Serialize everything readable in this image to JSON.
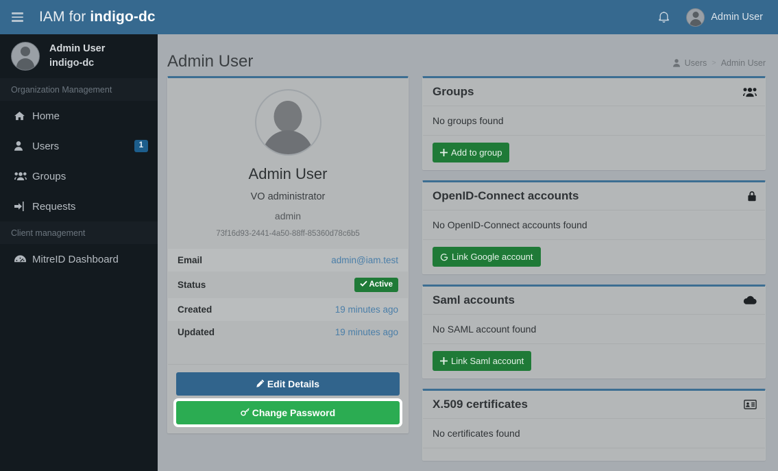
{
  "navbar": {
    "menu_icon": "hamburger-icon",
    "brand_prefix": "IAM for ",
    "brand_org": "indigo-dc",
    "bell_icon": "bell-icon",
    "user_name": "Admin User"
  },
  "sidebar": {
    "profile": {
      "name": "Admin User",
      "org": "indigo-dc"
    },
    "sections": [
      {
        "header": "Organization Management",
        "items": [
          {
            "label": "Home",
            "icon": "home-icon",
            "badge": null
          },
          {
            "label": "Users",
            "icon": "user-icon",
            "badge": "1"
          },
          {
            "label": "Groups",
            "icon": "users-icon",
            "badge": null
          },
          {
            "label": "Requests",
            "icon": "sign-in-icon",
            "badge": null
          }
        ]
      },
      {
        "header": "Client management",
        "items": [
          {
            "label": "MitreID Dashboard",
            "icon": "dashboard-icon",
            "badge": null
          }
        ]
      }
    ]
  },
  "content": {
    "page_title": "Admin User",
    "breadcrumb": {
      "icon": "user-icon",
      "link": "Users",
      "separator": ">",
      "current": "Admin User"
    }
  },
  "profile": {
    "avatar_icon": "avatar-placeholder-icon",
    "name": "Admin User",
    "role": "VO administrator",
    "username": "admin",
    "uuid": "73f16d93-2441-4a50-88ff-85360d78c6b5",
    "fields": [
      {
        "key": "Email",
        "value": "admin@iam.test",
        "type": "link"
      },
      {
        "key": "Status",
        "value": "Active",
        "type": "badge",
        "badge_icon": "check-icon"
      },
      {
        "key": "Created",
        "value": "19 minutes ago",
        "type": "link"
      },
      {
        "key": "Updated",
        "value": "19 minutes ago",
        "type": "link"
      }
    ],
    "actions": {
      "edit_label": "Edit Details",
      "edit_icon": "pencil-icon",
      "password_label": "Change Password",
      "password_icon": "key-icon"
    }
  },
  "panels": [
    {
      "title": "Groups",
      "icon": "users-group-icon",
      "empty_text": "No groups found",
      "button_label": "Add to group",
      "button_icon": "plus-icon"
    },
    {
      "title": "OpenID-Connect accounts",
      "icon": "lock-icon",
      "empty_text": "No OpenID-Connect accounts found",
      "button_label": "Link Google account",
      "button_icon": "google-icon"
    },
    {
      "title": "Saml accounts",
      "icon": "cloud-icon",
      "empty_text": "No SAML account found",
      "button_label": "Link Saml account",
      "button_icon": "plus-icon"
    },
    {
      "title": "X.509 certificates",
      "icon": "id-card-icon",
      "empty_text": "No certificates found",
      "button_label": null,
      "button_icon": null
    }
  ],
  "colors": {
    "navbar_blue": "#36698f",
    "sidebar_dark": "#131a1f",
    "content_bg": "#a7acb1",
    "panel_bg": "#b4b7b8",
    "panel_top_border": "#3c6e92",
    "success_green": "#1f7a37",
    "change_password_green": "#2bac52",
    "link_blue": "#4a7ea8",
    "badge_blue": "#1d5e8c"
  }
}
